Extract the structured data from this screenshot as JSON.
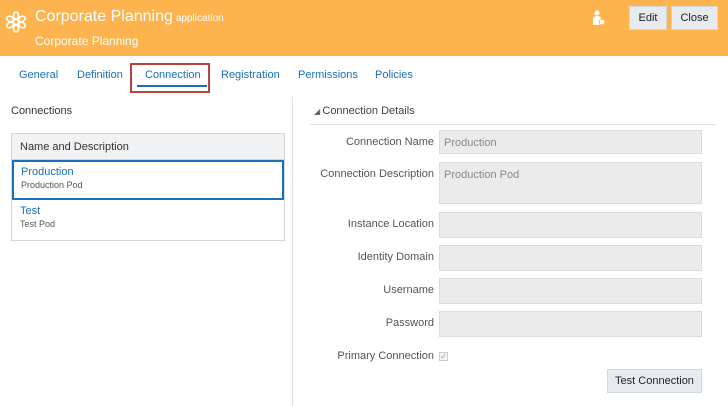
{
  "header": {
    "title": "Corporate Planning",
    "title_suffix": "application",
    "subtitle": "Corporate Planning",
    "edit_label": "Edit",
    "close_label": "Close"
  },
  "tabs": [
    "General",
    "Definition",
    "Connection",
    "Registration",
    "Permissions",
    "Policies"
  ],
  "active_tab": "Connection",
  "connections": {
    "heading": "Connections",
    "column": "Name and Description",
    "items": [
      {
        "name": "Production",
        "desc": "Production Pod"
      },
      {
        "name": "Test",
        "desc": "Test Pod"
      }
    ]
  },
  "details": {
    "heading": "Connection Details",
    "fields": [
      {
        "label": "Connection Name",
        "value": "Production"
      },
      {
        "label": "Connection Description",
        "value": "Production Pod"
      },
      {
        "label": "Instance Location",
        "value": ""
      },
      {
        "label": "Identity Domain",
        "value": ""
      },
      {
        "label": "Username",
        "value": ""
      },
      {
        "label": "Password",
        "value": ""
      }
    ],
    "primary_label": "Primary Connection",
    "primary_checked": true,
    "test_label": "Test Connection"
  }
}
